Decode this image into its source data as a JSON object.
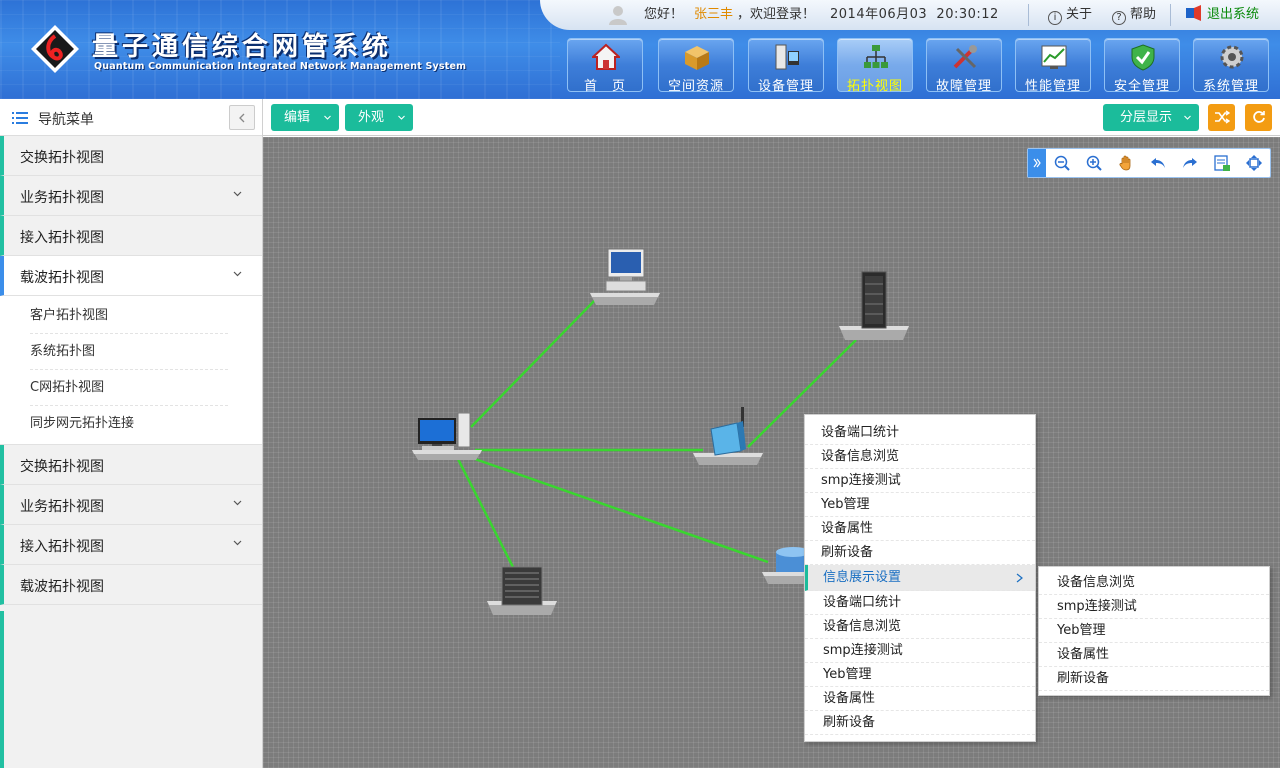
{
  "header": {
    "title": "量子通信综合网管系统",
    "subtitle": "Quantum Communication Integrated Network Management System",
    "greeting": "您好！",
    "user": "张三丰",
    "welcome": "，欢迎登录！",
    "datetime": "2014年06月03  20:30:12",
    "about": "关于",
    "help": "帮助",
    "logout": "退出系统"
  },
  "nav": [
    {
      "label": "首　页",
      "icon": "home-icon"
    },
    {
      "label": "空间资源",
      "icon": "box-icon"
    },
    {
      "label": "设备管理",
      "icon": "device-icon"
    },
    {
      "label": "拓扑视图",
      "icon": "topology-icon",
      "active": true
    },
    {
      "label": "故障管理",
      "icon": "tools-icon"
    },
    {
      "label": "性能管理",
      "icon": "chart-icon"
    },
    {
      "label": "安全管理",
      "icon": "shield-icon"
    },
    {
      "label": "系统管理",
      "icon": "gear-icon"
    }
  ],
  "sidebar": {
    "title": "导航菜单",
    "items": [
      {
        "label": "交换拓扑视图"
      },
      {
        "label": "业务拓扑视图"
      },
      {
        "label": "接入拓扑视图"
      },
      {
        "label": "载波拓扑视图"
      },
      {
        "label": "交换拓扑视图"
      },
      {
        "label": "业务拓扑视图"
      },
      {
        "label": "接入拓扑视图"
      },
      {
        "label": "载波拓扑视图"
      }
    ],
    "subitems": [
      "客户拓扑视图",
      "系统拓扑图",
      "C网拓扑视图",
      "同步网元拓扑连接"
    ]
  },
  "toolbar": {
    "edit": "编辑",
    "appearance": "外观",
    "layered": "分层显示"
  },
  "context_menu": {
    "items": [
      "设备端口统计",
      "设备信息浏览",
      "smp连接测试",
      "Yeb管理",
      "设备属性",
      "刷新设备"
    ],
    "highlighted": "信息展示设置",
    "items2": [
      "设备端口统计",
      "设备信息浏览",
      "smp连接测试",
      "Yeb管理",
      "设备属性",
      "刷新设备"
    ]
  },
  "submenu": {
    "items": [
      "设备信息浏览",
      "smp连接测试",
      "Yeb管理",
      "设备属性",
      "刷新设备"
    ]
  },
  "colors": {
    "accent": "#1bbc9b",
    "orange": "#f39c12",
    "link": "#39d62f",
    "header_blue": "#3f8de8"
  }
}
